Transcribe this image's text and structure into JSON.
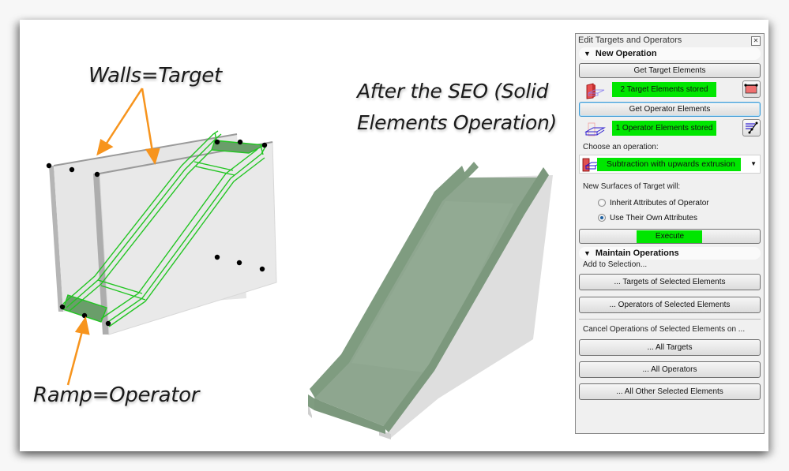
{
  "captions": {
    "walls_target": "Walls=Target",
    "ramp_operator": "Ramp=Operator",
    "after_line1": "After the SEO (Solid",
    "after_line2": "Elements Operation)"
  },
  "colors": {
    "highlight": "#00e600",
    "arrow": "#f7941d",
    "wireframe": "#22c522",
    "ramp_fill": "#8aa88a",
    "wall": "#e3e3e3"
  },
  "panel": {
    "title": "Edit Targets and Operators",
    "close_icon": "close-icon",
    "new_operation": {
      "heading": "New Operation",
      "get_target_label": "Get Target Elements",
      "target_status": "2  Target Elements stored",
      "get_operator_label": "Get Operator Elements",
      "operator_status": "1  Operator Elements stored",
      "choose_label": "Choose an operation:",
      "operation_selected": "Subtraction with upwards extrusion",
      "surfaces_label": "New Surfaces of Target will:",
      "radio_options": [
        {
          "label": "Inherit Attributes of Operator",
          "selected": false
        },
        {
          "label": "Use Their Own Attributes",
          "selected": true
        }
      ],
      "execute_label": "Execute"
    },
    "maintain": {
      "heading": "Maintain Operations",
      "add_label": "Add to Selection...",
      "add_buttons": [
        "... Targets of Selected Elements",
        "... Operators of Selected Elements"
      ],
      "cancel_label": "Cancel Operations of Selected Elements on ...",
      "cancel_buttons": [
        "... All Targets",
        "... All Operators",
        "... All Other Selected Elements"
      ]
    }
  }
}
